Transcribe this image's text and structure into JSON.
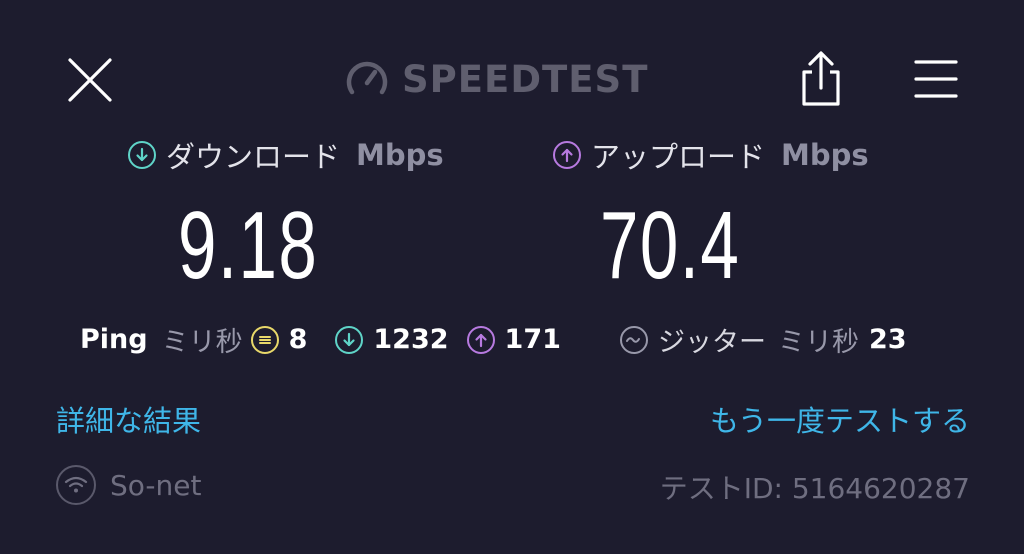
{
  "header": {
    "logo_text": "SPEEDTEST",
    "logo_icon": "speedometer-icon",
    "close_icon": "close-icon",
    "share_icon": "share-icon",
    "menu_icon": "hamburger-menu-icon"
  },
  "download": {
    "label": "ダウンロード",
    "unit": "Mbps",
    "value": "9.18",
    "icon": "download-arrow-icon",
    "color": "#5fd4c8"
  },
  "upload": {
    "label": "アップロード",
    "unit": "Mbps",
    "value": "70.4",
    "icon": "upload-arrow-icon",
    "color": "#b77ae0"
  },
  "ping": {
    "label": "Ping",
    "unit": "ミリ秒",
    "idle_value": "8",
    "download_value": "1232",
    "upload_value": "171",
    "idle_color": "#e8d86a"
  },
  "jitter": {
    "label": "ジッター",
    "unit": "ミリ秒",
    "value": "23",
    "icon": "jitter-wave-icon"
  },
  "links": {
    "details": "詳細な結果",
    "retest": "もう一度テストする"
  },
  "footer": {
    "isp": "So-net",
    "isp_icon": "wifi-icon",
    "test_id": "テストID: 5164620287"
  }
}
